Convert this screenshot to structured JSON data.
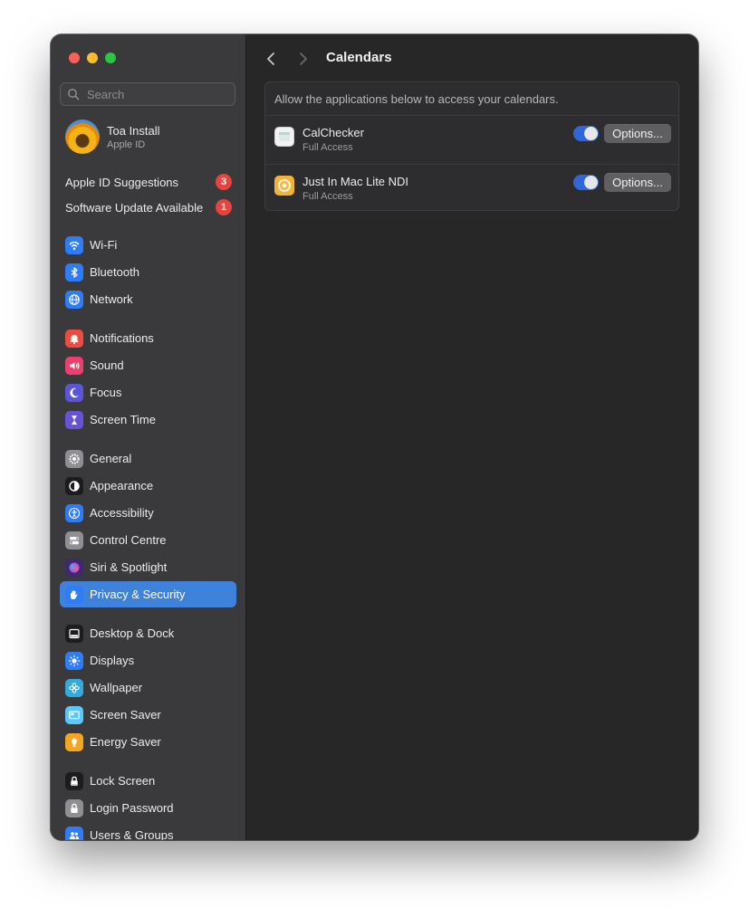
{
  "search": {
    "placeholder": "Search"
  },
  "account": {
    "name": "Toa Install",
    "subtitle": "Apple ID"
  },
  "notices": [
    {
      "label": "Apple ID Suggestions",
      "badge": "3"
    },
    {
      "label": "Software Update Available",
      "badge": "1"
    }
  ],
  "sidebar": {
    "items": [
      {
        "label": "Wi-Fi",
        "icon": "wifi-icon",
        "color": "#2f7cf6"
      },
      {
        "label": "Bluetooth",
        "icon": "bluetooth-icon",
        "color": "#2f7cf6"
      },
      {
        "label": "Network",
        "icon": "globe-icon",
        "color": "#2f7cf6"
      },
      {
        "label": "Notifications",
        "icon": "bell-icon",
        "color": "#ec4d43"
      },
      {
        "label": "Sound",
        "icon": "speaker-icon",
        "color": "#ec3f6f"
      },
      {
        "label": "Focus",
        "icon": "moon-icon",
        "color": "#5c56d6"
      },
      {
        "label": "Screen Time",
        "icon": "hourglass-icon",
        "color": "#6a52d6"
      },
      {
        "label": "General",
        "icon": "gear-icon",
        "color": "#8e8e93"
      },
      {
        "label": "Appearance",
        "icon": "appearance-icon",
        "color": "#1c1c1e"
      },
      {
        "label": "Accessibility",
        "icon": "accessibility-icon",
        "color": "#2f7cf6"
      },
      {
        "label": "Control Centre",
        "icon": "toggles-icon",
        "color": "#8e8e93"
      },
      {
        "label": "Siri & Spotlight",
        "icon": "siri-icon",
        "color": "#3b2a6e"
      },
      {
        "label": "Privacy & Security",
        "icon": "hand-icon",
        "color": "#2f7cf6",
        "selected": true
      },
      {
        "label": "Desktop & Dock",
        "icon": "dock-icon",
        "color": "#1c1c1e"
      },
      {
        "label": "Displays",
        "icon": "sun-icon",
        "color": "#2f7cf6"
      },
      {
        "label": "Wallpaper",
        "icon": "flower-icon",
        "color": "#34aadc"
      },
      {
        "label": "Screen Saver",
        "icon": "screensaver-icon",
        "color": "#5ac8fa"
      },
      {
        "label": "Energy Saver",
        "icon": "lightbulb-icon",
        "color": "#f4a623"
      },
      {
        "label": "Lock Screen",
        "icon": "lock-icon",
        "color": "#1c1c1e"
      },
      {
        "label": "Login Password",
        "icon": "padlock-icon",
        "color": "#8e8e93"
      },
      {
        "label": "Users & Groups",
        "icon": "users-icon",
        "color": "#2f7cf6"
      }
    ]
  },
  "main": {
    "title": "Calendars",
    "description": "Allow the applications below to access your calendars.",
    "apps": [
      {
        "name": "CalChecker",
        "access": "Full Access",
        "enabled": true,
        "options_label": "Options..."
      },
      {
        "name": "Just In Mac Lite NDI",
        "access": "Full Access",
        "enabled": true,
        "options_label": "Options..."
      }
    ]
  }
}
